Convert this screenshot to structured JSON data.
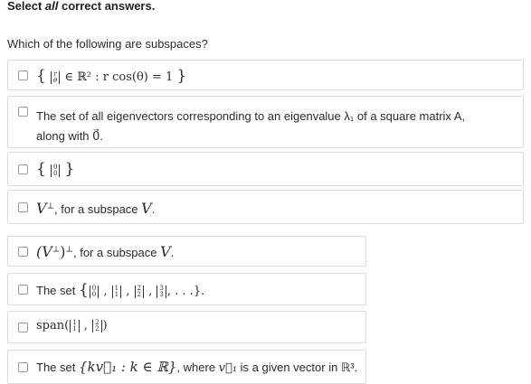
{
  "instruction": {
    "prefix": "Select ",
    "emph": "all",
    "suffix": " correct answers."
  },
  "question": "Which of the following are subspaces?",
  "options": [
    {
      "id": "opt1",
      "text_a": "r",
      "text_b": "θ",
      "text_rest": " ∈ ℝ² : r cos(θ) = 1"
    },
    {
      "id": "opt2",
      "line1": "The set of all eigenvectors corresponding to an eigenvalue λ₁ of a square matrix A,",
      "line2": "along with 0⃗."
    },
    {
      "id": "opt3",
      "v_top": "0",
      "v_bot": "0"
    },
    {
      "id": "opt4",
      "sym": "V",
      "sup": "⊥",
      "text": ", for a subspace ",
      "var": "V",
      "end": "."
    },
    {
      "id": "opt5",
      "sym": "(V",
      "sup": "⊥",
      "close": ")",
      "sup2": "⊥",
      "text": ", for a subspace ",
      "var": "V",
      "end": "."
    },
    {
      "id": "opt6",
      "prefix": "The set ",
      "vectors": [
        [
          "0",
          "0"
        ],
        [
          "1",
          "1"
        ],
        [
          "2",
          "2"
        ],
        [
          "3",
          "3"
        ]
      ],
      "tail": ", . . .}."
    },
    {
      "id": "opt7",
      "fn": "span(",
      "vectors": [
        [
          "1",
          "1"
        ],
        [
          "2",
          "2"
        ]
      ],
      "close": ")"
    },
    {
      "id": "opt8",
      "prefix": "The set ",
      "setexpr": "{kv⃗₁ : k ∈ ℝ}",
      "mid": ", where ",
      "v": "v⃗₁",
      "suffix": " is a given vector in ℝ³."
    }
  ]
}
